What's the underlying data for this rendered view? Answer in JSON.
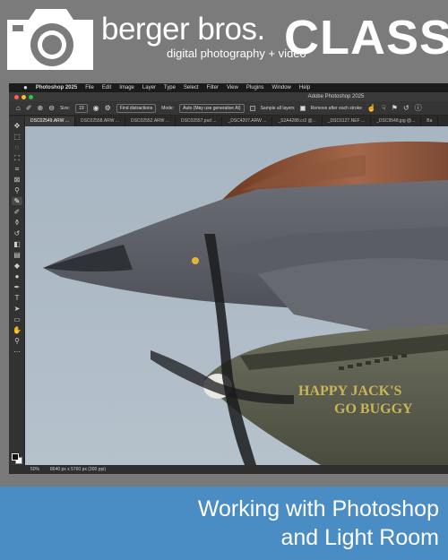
{
  "banner": {
    "brand_name": "berger bros.",
    "tagline": "digital photography + video",
    "class_label": "CLASS"
  },
  "photoshop": {
    "menu": [
      "Photoshop 2025",
      "File",
      "Edit",
      "Image",
      "Layer",
      "Type",
      "Select",
      "Filter",
      "View",
      "Plugins",
      "Window",
      "Help"
    ],
    "window_title": "Adobe Photoshop 2025",
    "options": {
      "size_label": "Size:",
      "size_value": "19",
      "find_distractions_label": "Find distractions",
      "mode_label": "Mode:",
      "mode_value": "Auto (May use generative AI)",
      "sample_all_layers_label": "Sample all layers",
      "sample_all_layers_checked": false,
      "remove_after_stroke_label": "Remove after each stroke",
      "remove_after_stroke_checked": true
    },
    "tabs": [
      "DSC02549.ARW ...",
      "DSC02558.ARW ...",
      "DSC02552.ARW ...",
      "DSC02557.psd ...",
      "_DSC4207.ARW ...",
      "_S2A4288.cr2 @...",
      "_DSC6127.NEF ...",
      "_DSC9548.jpg @...",
      "Ba"
    ],
    "active_tab_index": 0,
    "tools": [
      "move-icon",
      "marquee-icon",
      "lasso-icon",
      "object-select-icon",
      "crop-icon",
      "frame-icon",
      "eyedropper-icon",
      "remove-tool-icon",
      "brush-icon",
      "stamp-icon",
      "history-brush-icon",
      "eraser-icon",
      "gradient-icon",
      "blur-icon",
      "dodge-icon",
      "pen-icon",
      "type-icon",
      "path-select-icon",
      "rectangle-icon",
      "hand-icon",
      "zoom-icon",
      "more-tools-icon"
    ],
    "active_tool_index": 7,
    "status": {
      "zoom": "50%",
      "doc_info": "8640 px x 5760 px (300 ppi)"
    },
    "canvas": {
      "nose_art_line1": "HAPPY JACK'S",
      "nose_art_line2": "GO BUGGY"
    }
  },
  "footer": {
    "line1": "Working with Photoshop",
    "line2": "and Light Room"
  },
  "colors": {
    "banner_bg": "#7b7b7b",
    "footer_bg": "#4a8cc4",
    "sky": "#aab8c4",
    "jet_gray": "#5d6168",
    "warbird_olive": "#5a5d4c",
    "nose_art_yellow": "#c9b456"
  }
}
